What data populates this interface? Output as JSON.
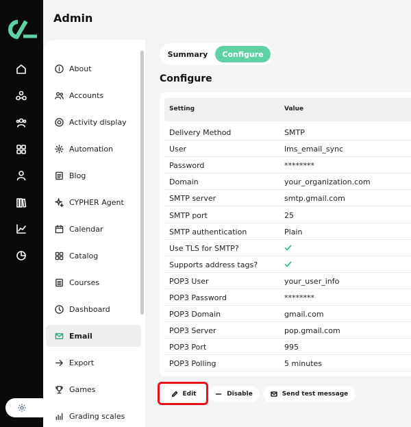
{
  "header": {
    "title": "Admin"
  },
  "rail": {
    "icons": [
      "logo-icon",
      "home-icon",
      "network-icon",
      "users-icon",
      "grid-icon",
      "user-icon",
      "library-icon",
      "chart-line-icon",
      "pie-chart-icon",
      "settings-icon"
    ]
  },
  "sidebar": {
    "items": [
      {
        "label": "About",
        "icon": "info-icon"
      },
      {
        "label": "Accounts",
        "icon": "users-icon"
      },
      {
        "label": "Activity display",
        "icon": "target-icon"
      },
      {
        "label": "Automation",
        "icon": "gear-icon"
      },
      {
        "label": "Blog",
        "icon": "document-icon"
      },
      {
        "label": "CYPHER Agent",
        "icon": "sparkle-icon"
      },
      {
        "label": "Calendar",
        "icon": "calendar-icon"
      },
      {
        "label": "Catalog",
        "icon": "grid-icon"
      },
      {
        "label": "Courses",
        "icon": "list-icon"
      },
      {
        "label": "Dashboard",
        "icon": "gauge-icon"
      },
      {
        "label": "Email",
        "icon": "mail-icon",
        "active": true
      },
      {
        "label": "Export",
        "icon": "arrow-right-icon"
      },
      {
        "label": "Games",
        "icon": "trophy-icon"
      },
      {
        "label": "Grading scales",
        "icon": "bar-chart-icon"
      }
    ]
  },
  "tabs": {
    "summary": "Summary",
    "configure": "Configure"
  },
  "section": {
    "title": "Configure"
  },
  "table": {
    "headers": {
      "setting": "Setting",
      "value": "Value"
    },
    "rows": [
      {
        "setting": "Delivery Method",
        "value": "SMTP"
      },
      {
        "setting": "User",
        "value": "lms_email_sync"
      },
      {
        "setting": "Password",
        "value": "********"
      },
      {
        "setting": "Domain",
        "value": "your_organization.com"
      },
      {
        "setting": "SMTP server",
        "value": "smtp.gmail.com"
      },
      {
        "setting": "SMTP port",
        "value": "25"
      },
      {
        "setting": "SMTP authentication",
        "value": "Plain"
      },
      {
        "setting": "Use TLS for SMTP?",
        "value": "",
        "check": true
      },
      {
        "setting": "Supports address tags?",
        "value": "",
        "check": true
      },
      {
        "setting": "POP3 User",
        "value": "your_user_info"
      },
      {
        "setting": "POP3 Password",
        "value": "********"
      },
      {
        "setting": "POP3 Domain",
        "value": "gmail.com"
      },
      {
        "setting": "POP3 Server",
        "value": "pop.gmail.com"
      },
      {
        "setting": "POP3 Port",
        "value": "995"
      },
      {
        "setting": "POP3 Polling",
        "value": "5 minutes"
      }
    ]
  },
  "actions": {
    "edit_label": "Edit",
    "disable_label": "Disable",
    "test_label": "Send test message"
  },
  "colors": {
    "accent": "#5fd1a5",
    "highlight": "#e8121b",
    "rail": "#0a0a0a"
  }
}
